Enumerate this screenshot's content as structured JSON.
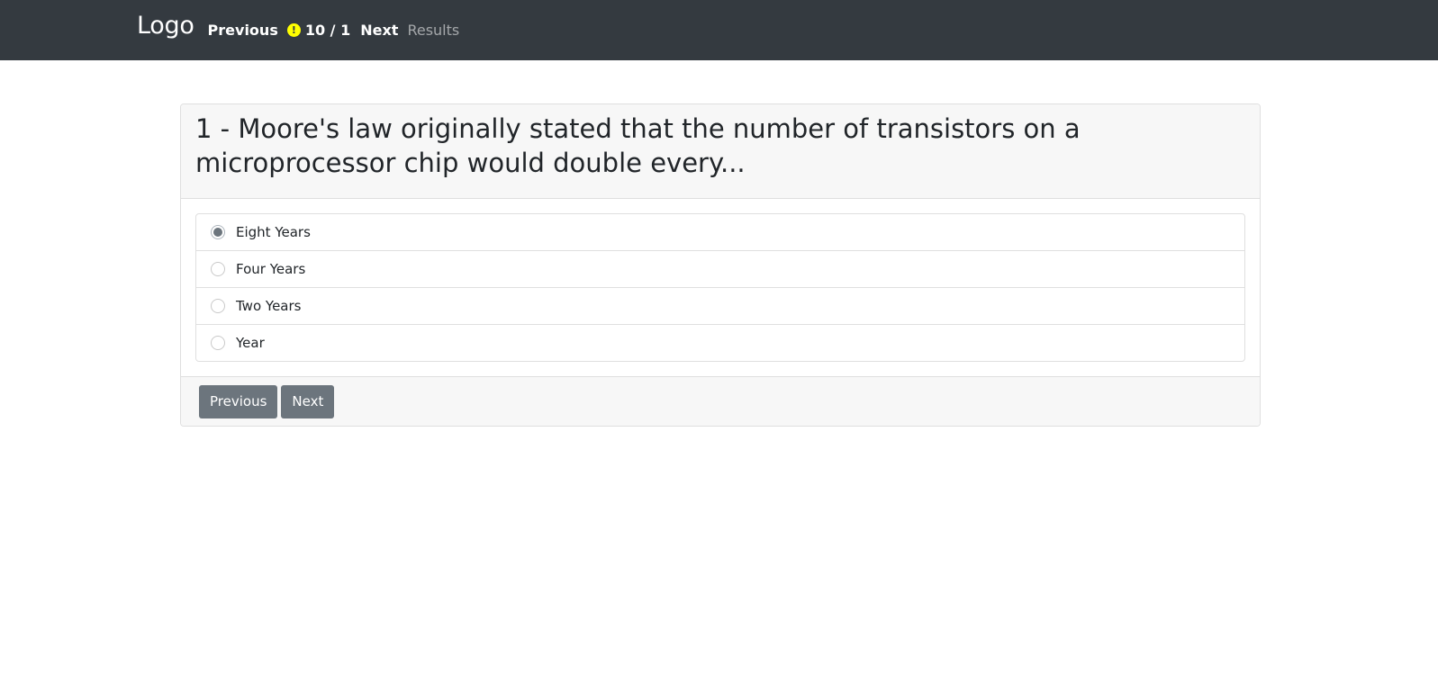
{
  "nav": {
    "brand": "Logo",
    "previous": "Previous",
    "counter_icon": "!",
    "counter": "10 / 1",
    "next": "Next",
    "results": "Results"
  },
  "question": {
    "title": "1 - Moore's law originally stated that the number of transistors on a microprocessor chip would double every...",
    "options": [
      {
        "label": "Eight Years",
        "selected": true
      },
      {
        "label": "Four Years",
        "selected": false
      },
      {
        "label": "Two Years",
        "selected": false
      },
      {
        "label": "Year",
        "selected": false
      }
    ]
  },
  "footer": {
    "previous": "Previous",
    "next": "Next"
  }
}
